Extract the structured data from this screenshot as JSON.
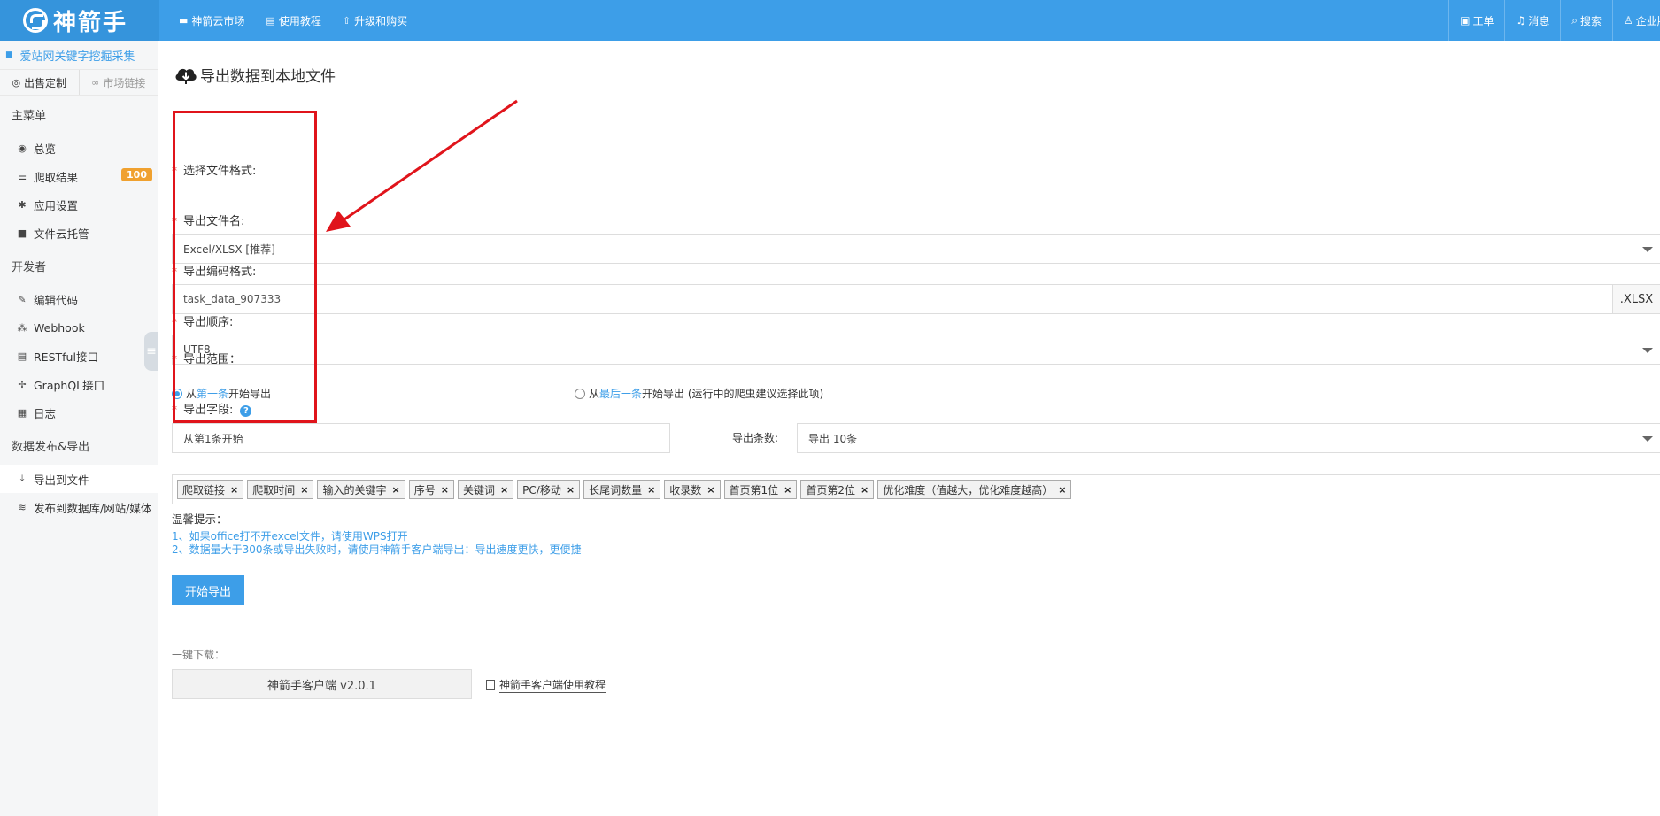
{
  "topbar": {
    "logo_text": "神箭手",
    "nav": [
      {
        "label": "神箭云市场"
      },
      {
        "label": "使用教程"
      },
      {
        "label": "升级和购买"
      }
    ],
    "right": [
      {
        "label": "工单"
      },
      {
        "label": "消息"
      },
      {
        "label": "搜索"
      },
      {
        "label": "企业版"
      }
    ]
  },
  "sidebar": {
    "task_title": "爱站网关键字挖掘采集",
    "actions": {
      "sell": "出售定制",
      "market_link": "市场链接"
    },
    "sections": {
      "main_menu": "主菜单",
      "developer": "开发者",
      "publish_export": "数据发布&导出"
    },
    "main_items": [
      {
        "label": "总览"
      },
      {
        "label": "爬取结果",
        "badge": "100"
      },
      {
        "label": "应用设置"
      },
      {
        "label": "文件云托管"
      }
    ],
    "dev_items": [
      {
        "label": "编辑代码"
      },
      {
        "label": "Webhook"
      },
      {
        "label": "RESTful接口"
      },
      {
        "label": "GraphQL接口"
      },
      {
        "label": "日志"
      }
    ],
    "publish_items": [
      {
        "label": "导出到文件"
      },
      {
        "label": "发布到数据库/网站/媒体"
      }
    ]
  },
  "main": {
    "page_title": "导出数据到本地文件",
    "required_mark": "*",
    "format": {
      "label": "选择文件格式:",
      "value": "Excel/XLSX [推荐]"
    },
    "filename": {
      "label": "导出文件名:",
      "value": "task_data_907333",
      "suffix": ".XLSX"
    },
    "encoding": {
      "label": "导出编码格式:",
      "value": "UTF8"
    },
    "order": {
      "label": "导出顺序:",
      "opt1_a": "从",
      "opt1_b": "第一条",
      "opt1_c": "开始导出",
      "opt2_a": "从",
      "opt2_b": "最后一条",
      "opt2_c": "开始导出 (运行中的爬虫建议选择此项)"
    },
    "range": {
      "label": "导出范围：",
      "value": "从第1条开始",
      "count_label": "导出条数:",
      "count_value": "导出 10条"
    },
    "fields": {
      "label": "导出字段:",
      "help": "?",
      "remove": "×",
      "tags": [
        "爬取链接",
        "爬取时间",
        "输入的关键字",
        "序号",
        "关键词",
        "PC/移动",
        "长尾词数量",
        "收录数",
        "首页第1位",
        "首页第2位",
        "优化难度（值越大，优化难度越高）"
      ]
    },
    "tips": {
      "title": "温馨提示：",
      "line1": "1、如果office打不开excel文件，请使用WPS打开",
      "line2": "2、数据量大于300条或导出失败时，请使用神箭手客户端导出：导出速度更快，更便捷"
    },
    "start_button": "开始导出",
    "download": {
      "label": "一键下载：",
      "client_button": "神箭手客户端 v2.0.1",
      "tutorial_link": "神箭手客户端使用教程"
    }
  }
}
